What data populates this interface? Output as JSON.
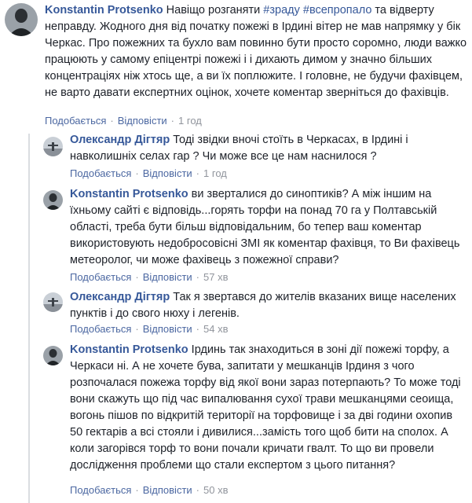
{
  "comments": [
    {
      "author": "Konstantin Protsenko",
      "text_pre": " Навіщо розганяти ",
      "tag1": "#зраду",
      "mid": " ",
      "tag2": "#всепропало",
      "text_post": " та відверту неправду. Жодного дня від початку пожежі в Ірдині вітер не мав напрямку у бік Черкас. Про пожежних та бухло вам повинно бути просто соромно, люди важко працюють у самому епіцентрі пожежі і і дихають димом у значно більших концентраціях ніж хтось ще, а ви їх поплюжите. І головне, не будучи фахівцем, не варто давати експертних оцінок, хочете коментар зверніться до фахівців.",
      "like": "Подобається",
      "reply": "Відповісти",
      "time": "1 год"
    },
    {
      "author": "Олександр Дігтяр",
      "text": " Тоді звідки вночі стоїть в Черкасах, в Ірдині і навколишніх селах гар ? Чи може все це нам наснилося ?",
      "like": "Подобається",
      "reply": "Відповісти",
      "time": "1 год"
    },
    {
      "author": "Konstantin Protsenko",
      "text": " ви зверталися до синоптиків? А між іншим на їхньому сайті є відповідь...горять торфи на понад 70 га у Полтавській області, треба бути більш відповідальним, бо тепер ваш коментар використовують недобросовісні ЗМІ як коментар фахівця, то Ви фахівець метеоролог, чи може фахівець з пожежної справи?",
      "like": "Подобається",
      "reply": "Відповісти",
      "time": "57 хв"
    },
    {
      "author": "Олександр Дігтяр",
      "text": " Так я звертався до жителів вказаних вище населених пунктів і до свого нюху і легенів.",
      "like": "Подобається",
      "reply": "Відповісти",
      "time": "54 хв"
    },
    {
      "author": "Konstantin Protsenko",
      "text": " Ірдинь так знаходиться в зоні дії пожежі торфу, а Черкаси ні. А не хочете бува, запитати у мешканців Ірдиня з чого розпочалася пожежа торфу від якої вони зараз потерпають? То може тоді вони скажуть що під час випалювання сухої трави мешканцями сеоища, вогонь пішов по відкритій території на торфовище і за дві години охопив 50 гектарів а всі стояли і дивилися...замість того щоб бити на сполох. А коли загорівся торф то вони почали кричати гвалт. То що ви провели дослідження проблеми що стали експертом з цього питання?",
      "like": "Подобається",
      "reply": "Відповісти",
      "time": "50 хв"
    }
  ]
}
